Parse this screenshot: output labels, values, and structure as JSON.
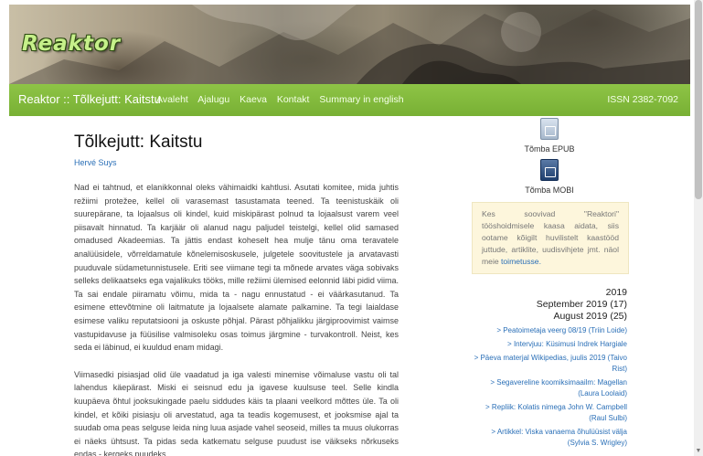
{
  "header": {
    "logo_text": "Reaktor"
  },
  "navbar": {
    "brand": "Reaktor :: Tõlkejutt: Kaitstu",
    "links": [
      "Avaleht",
      "Ajalugu",
      "Kaeva",
      "Kontakt",
      "Summary in english"
    ],
    "issn": "ISSN 2382-7092"
  },
  "article": {
    "title": "Tõlkejutt: Kaitstu",
    "author": "Hervé Suys",
    "paragraphs": [
      "Nad ei tahtnud, et elanikkonnal oleks vähimaidki kahtlusi. Asutati komitee, mida juhtis režiimi protežee, kellel oli varasemast tasustamata teened. Ta teenistuskäik oli suurepärane, ta lojaalsus oli kindel, kuid miskipärast polnud ta lojaalsust varem veel piisavalt hinnatud. Ta karjäär oli alanud nagu paljudel teistelgi, kellel olid samased omadused Akadeemias. Ta jättis endast koheselt hea mulje tänu oma teravatele analüüsidele, võrreldamatule kõnelemisoskusele, julgetele soovitustele ja arvatavasti puuduvale südametunnistusele.   Eriti see viimane tegi ta mõnede arvates väga sobivaks selleks delikaatseks ega vajalikuks tööks, mille režiimi ülemised eelonnid läbi pidid viima. Ta sai endale piiramatu võimu, mida ta - nagu ennustatud - ei väärkasutanud. Ta esimene ettevõtmine oli laitmatute ja lojaalsete alamate palkamine. Ta tegi laialdase esimese valiku reputatsiooni ja oskuste põhjal. Pärast põhjalikku järgiproovimist vaimse vastupidavuse ja füüsilise valmisoleku osas toimus järgmine - turvakontroll. Neist, kes seda ei läbinud, ei kuuldud enam midagi.",
      "Viimasedki pisiasjad olid üle vaadatud ja iga valesti minemise võimaluse vastu oli tal lahendus käepärast. Miski ei seisnud edu ja igavese kuulsuse teel. Selle kindla kuupäeva õhtul jooksukingade paelu siddudes käis ta plaani veelkord mõttes üle. Ta oli kindel, et kõiki pisiasju oli arvestatud, aga ta teadis kogemusest, et jooksmise ajal ta suudab oma peas selguse leida ning luua asjade vahel seoseid, milles ta muus olukorras ei näeks ühtsust. Ta pidas seda katkematu selguse puudust ise väikseks nõrkuseks endas - kergeks puudeks."
    ]
  },
  "sidebar": {
    "epub_label": "Tõmba EPUB",
    "mobi_label": "Tõmba MOBI",
    "info_text": "Kes soovivad \"Reaktori\" tööshoidmisele kaasa aidata, siis ootame kõigilt huvilistelt kaastööd juttude, artiklite, uudisvihjete jmt. näol meie ",
    "info_link": "toimetusse.",
    "archive_year": "2019",
    "archive_months": [
      "September 2019 (17)",
      "August 2019 (25)"
    ],
    "archive_items": [
      "> Peatoimetaja veerg 08/19 (Triin Loide)",
      "> Intervjuu: Küsimusi Indrek Hargiale",
      "> Päeva materjal Wikipedias, juulis 2019 (Taivo Rist)",
      "> Segavereline koomiksimaailm: Magellan (Laura Loolaid)",
      "> Repliik: Kolatis nimega John W. Campbell (Raul Sulbi)",
      "> Artikkel: Viska vanaema õhulüüsist välja (Sylvia S. Wrigley)"
    ]
  },
  "colors": {
    "navbar_green": "#82b83c",
    "link_blue": "#2a6fb7",
    "infobox_bg": "#fdf6dc"
  }
}
